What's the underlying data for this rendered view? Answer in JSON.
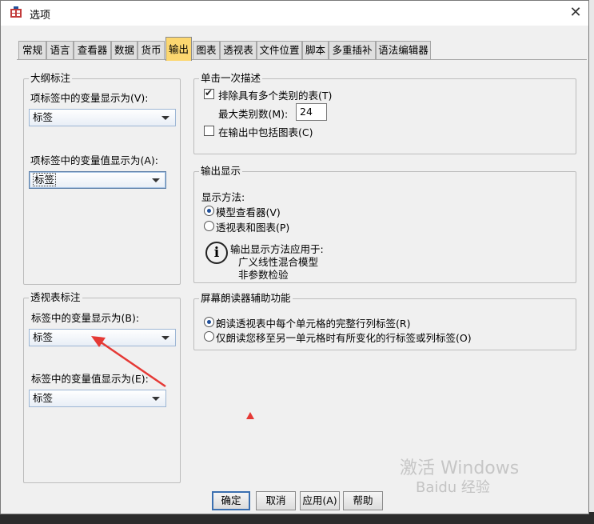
{
  "window": {
    "title": "选项",
    "close": "✕"
  },
  "tabs": [
    {
      "label": "常规"
    },
    {
      "label": "语言"
    },
    {
      "label": "查看器"
    },
    {
      "label": "数据"
    },
    {
      "label": "货币"
    },
    {
      "label": "输出",
      "active": true
    },
    {
      "label": "图表"
    },
    {
      "label": "透视表"
    },
    {
      "label": "文件位置"
    },
    {
      "label": "脚本"
    },
    {
      "label": "多重插补"
    },
    {
      "label": "语法编辑器"
    }
  ],
  "outline": {
    "title": "大纲标注",
    "var_label": "项标签中的变量显示为(V):",
    "var_value": "标签",
    "val_label": "项标签中的变量值显示为(A):",
    "val_value": "标签"
  },
  "pivot": {
    "title": "透视表标注",
    "var_label": "标签中的变量显示为(B):",
    "var_value": "标签",
    "val_label": "标签中的变量值显示为(E):",
    "val_value": "标签"
  },
  "single_click": {
    "title": "单击一次描述",
    "exclude_label": "排除具有多个类别的表(T)",
    "exclude_checked": true,
    "max_label": "最大类别数(M):",
    "max_value": "24",
    "include_label": "在输出中包括图表(C)",
    "include_checked": false
  },
  "output_display": {
    "title": "输出显示",
    "method_label": "显示方法:",
    "opt_model": "模型查看器(V)",
    "opt_pivot": "透视表和图表(P)",
    "selected": "model",
    "info_text": "输出显示方法应用于:",
    "info_items": [
      "广义线性混合模型",
      "非参数检验"
    ]
  },
  "screen_reader": {
    "title": "屏幕朗读器辅助功能",
    "opt_full": "朗读透视表中每个单元格的完整行列标签(R)",
    "opt_changed": "仅朗读您移至另一单元格时有所变化的行标签或列标签(O)",
    "selected": "full"
  },
  "buttons": {
    "ok": "确定",
    "cancel": "取消",
    "apply": "应用(A)",
    "help": "帮助"
  },
  "watermark": {
    "line1": "激活 Windows",
    "line2": "Baidu 经验"
  },
  "colors": {
    "active_tab": "#fcd770",
    "default_button_border": "#3a6fb0",
    "annotation_arrow": "#e53935"
  }
}
